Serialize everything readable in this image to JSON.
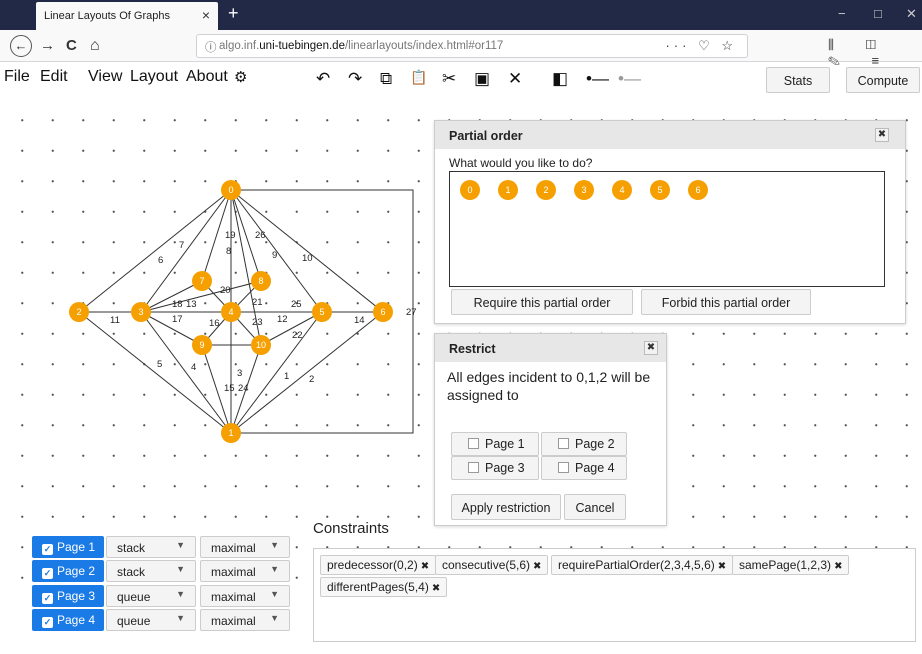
{
  "browser": {
    "tab_title": "Linear Layouts Of Graphs",
    "tab_close": "×",
    "new_tab": "+",
    "win_min": "−",
    "win_max": "□",
    "win_close": "✕",
    "back": "←",
    "forward": "→",
    "reload": "C",
    "home": "⌂",
    "url_prefix": "algo.inf.",
    "url_host": "uni-tuebingen.de",
    "url_path": "/linearlayouts/index.html#or117",
    "url_actions": "··· ♡ ☆",
    "right_icons": "⫼ ◫ ✎ ≡"
  },
  "menubar": {
    "items": [
      "File",
      "Edit",
      "View",
      "Layout",
      "About"
    ],
    "settings_icon": "⚙",
    "tools": [
      "↶",
      "↷",
      "⧉",
      "📋",
      "✂",
      "▣",
      "✕",
      "◧",
      "•—",
      "•—"
    ],
    "stats": "Stats",
    "compute": "Compute"
  },
  "graph": {
    "nodes": [
      {
        "id": "0"
      },
      {
        "id": "1"
      },
      {
        "id": "2"
      },
      {
        "id": "3"
      },
      {
        "id": "4"
      },
      {
        "id": "5"
      },
      {
        "id": "6"
      },
      {
        "id": "7"
      },
      {
        "id": "8"
      },
      {
        "id": "9"
      },
      {
        "id": "10"
      }
    ],
    "edge_labels": [
      "6",
      "7",
      "19",
      "8",
      "26",
      "9",
      "10",
      "18",
      "13",
      "17",
      "20",
      "21",
      "25",
      "12",
      "23",
      "16",
      "22",
      "11",
      "14",
      "27",
      "5",
      "4",
      "3",
      "15",
      "24",
      "1",
      "2"
    ]
  },
  "partial_order": {
    "title": "Partial order",
    "close": "✖",
    "prompt": "What would you like to do?",
    "nodes": [
      "0",
      "1",
      "2",
      "3",
      "4",
      "5",
      "6"
    ],
    "require_button": "Require this partial order",
    "forbid_button": "Forbid this partial order"
  },
  "restrict": {
    "title": "Restrict",
    "close": "✖",
    "message": "All edges incident to 0,1,2 will be assigned to",
    "pages": [
      "Page 1",
      "Page 2",
      "Page 3",
      "Page 4"
    ],
    "apply_button": "Apply restriction",
    "cancel_button": "Cancel"
  },
  "pages": [
    {
      "label": "Page 1",
      "type": "stack",
      "mode": "maximal"
    },
    {
      "label": "Page 2",
      "type": "stack",
      "mode": "maximal"
    },
    {
      "label": "Page 3",
      "type": "queue",
      "mode": "maximal"
    },
    {
      "label": "Page 4",
      "type": "queue",
      "mode": "maximal"
    }
  ],
  "constraints": {
    "title": "Constraints",
    "chips": [
      "predecessor(0,2)",
      "consecutive(5,6)",
      "requirePartialOrder(2,3,4,5,6)",
      "samePage(1,2,3)",
      "differentPages(5,4)"
    ],
    "chip_close": "✖"
  },
  "colors": {
    "node": "#f5a000",
    "page_button": "#1a7ae6",
    "tab_bar": "#222946"
  }
}
